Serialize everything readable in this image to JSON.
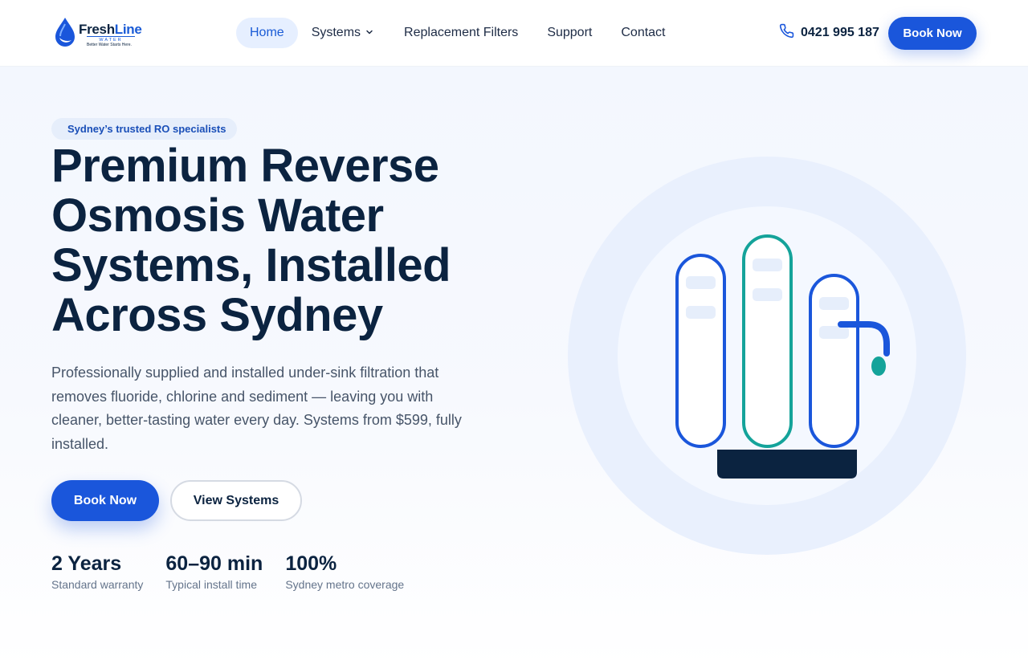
{
  "brand": {
    "name_part1": "Fresh",
    "name_part2": "Line",
    "subtitle": "WATER",
    "tagline": "Better Water Starts Here.",
    "primary_color": "#1a56db",
    "dark_color": "#0b2340",
    "teal_color": "#14a39a"
  },
  "nav": {
    "items": [
      {
        "label": "Home",
        "active": true
      },
      {
        "label": "Systems",
        "has_dropdown": true
      },
      {
        "label": "Replacement Filters"
      },
      {
        "label": "Support"
      },
      {
        "label": "Contact"
      }
    ]
  },
  "header": {
    "phone_icon": "phone-icon",
    "phone": "0421 995 187",
    "book_label": "Book Now"
  },
  "hero": {
    "badge": "Sydney’s trusted RO specialists",
    "headline": "Premium Reverse Osmosis Water Systems, Installed Across Sydney",
    "subcopy": "Professionally supplied and installed under-sink filtration that removes fluoride, chlorine and sediment — leaving you with cleaner, better-tasting water every day. Systems from $599, fully installed.",
    "primary_cta": "Book Now",
    "secondary_cta": "View Systems",
    "stats": [
      {
        "value": "2 Years",
        "label": "Standard warranty"
      },
      {
        "value": "60–90 min",
        "label": "Typical install time"
      },
      {
        "value": "100%",
        "label": "Sydney metro coverage"
      }
    ],
    "illustration_icon": "ro-filter-system-icon"
  }
}
